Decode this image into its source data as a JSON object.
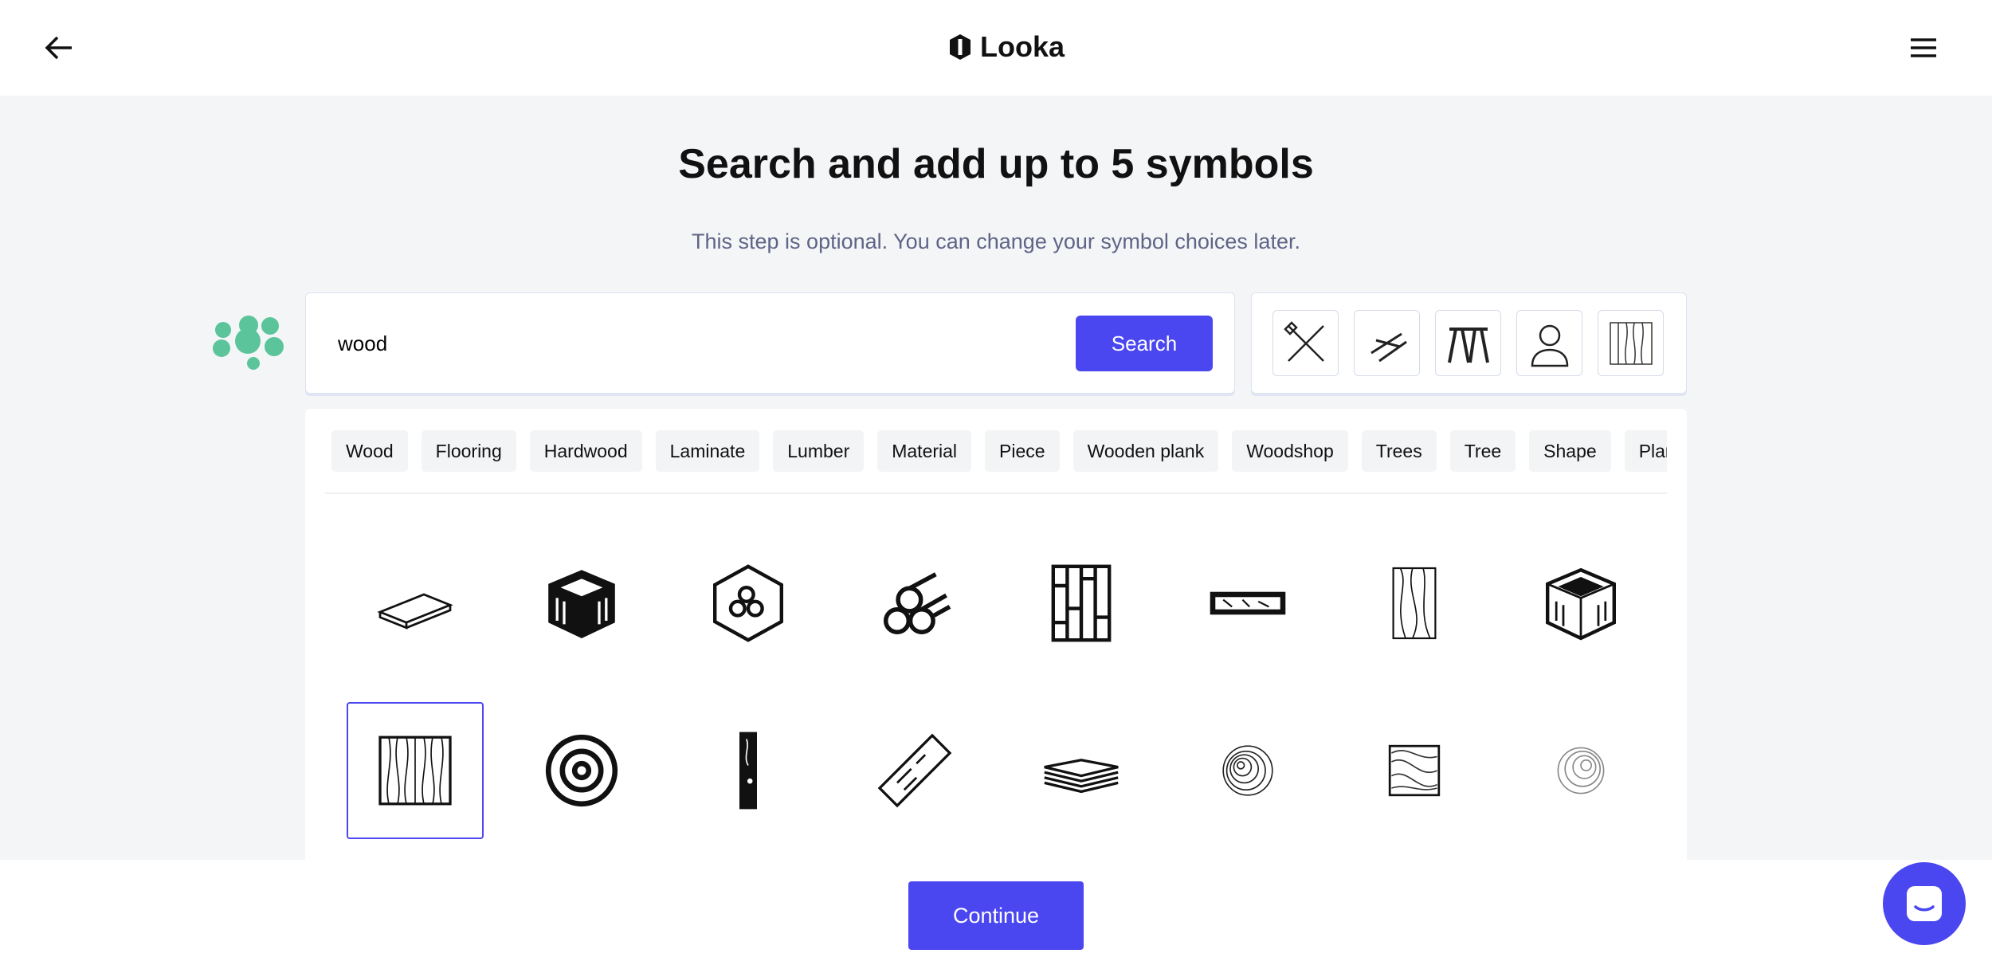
{
  "header": {
    "brand": "Looka",
    "back_icon": "arrow-left-icon",
    "menu_icon": "hamburger-menu-icon"
  },
  "page": {
    "title": "Search and add up to 5 symbols",
    "subtitle": "This step is optional. You can change your symbol choices later."
  },
  "search": {
    "value": "wood",
    "button_label": "Search"
  },
  "selected_symbols": [
    "hammer-and-wrench",
    "nails",
    "sawhorse",
    "carpenter",
    "wood-grain-square"
  ],
  "tags": [
    "Wood",
    "Flooring",
    "Hardwood",
    "Laminate",
    "Lumber",
    "Material",
    "Piece",
    "Wooden plank",
    "Woodshop",
    "Trees",
    "Tree",
    "Shape",
    "Plant"
  ],
  "results": [
    "wood-plank",
    "wood-cube-dark",
    "logs-hexagon",
    "log-pile",
    "parquet-floor",
    "wood-beam",
    "wood-grain-board",
    "wood-cube",
    "wood-grain-square",
    "tree-rings",
    "wood-board-vertical",
    "diagonal-plank",
    "stacked-planks",
    "round-tree-rings",
    "square-grain",
    "round-grain-light"
  ],
  "selected_result_index": 8,
  "footer": {
    "continue_label": "Continue"
  },
  "colors": {
    "accent": "#4b47f0",
    "green": "#5cc49a"
  }
}
